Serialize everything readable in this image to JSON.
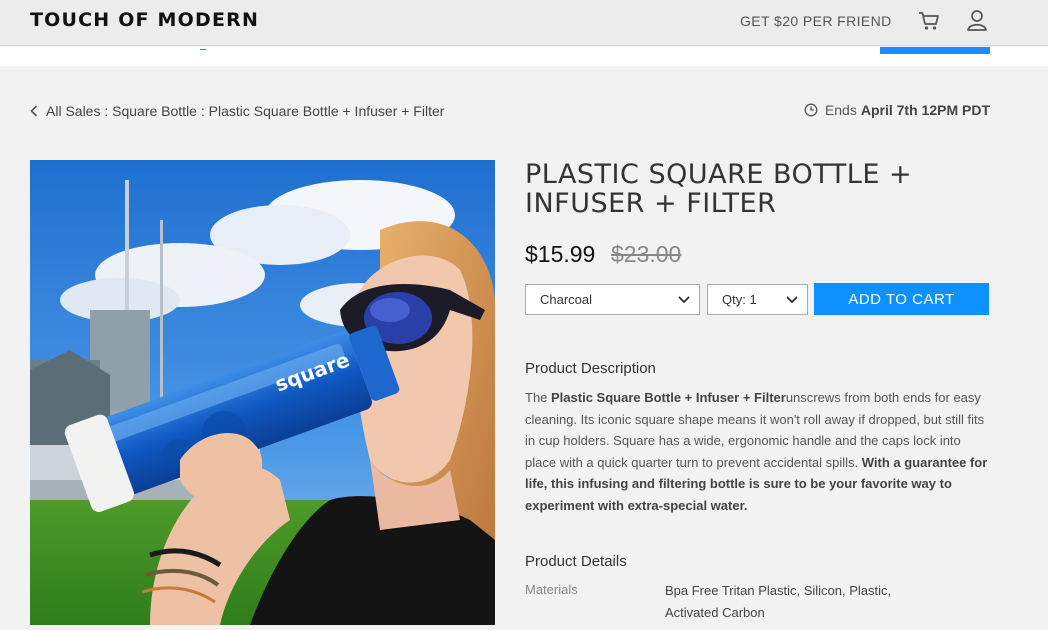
{
  "header": {
    "logo": "TOUCH OF MODERN",
    "invite_label": "GET $20 PER FRIEND",
    "cart_icon": "cart-icon",
    "user_icon": "user-icon"
  },
  "breadcrumb": {
    "text": "All Sales : Square Bottle : Plastic Square Bottle + Infuser + Filter"
  },
  "sale_end": {
    "prefix": "Ends",
    "date": "April 7th 12PM PDT"
  },
  "product": {
    "title": "PLASTIC SQUARE BOTTLE + INFUSER + FILTER",
    "price": "$15.99",
    "original_price": "$23.00",
    "color_option": "Charcoal",
    "qty_option": "Qty: 1",
    "add_to_cart": "ADD TO CART",
    "image_alt": "Woman drinking from a blue square bottle outdoors",
    "bottle_logo": "square"
  },
  "description": {
    "heading": "Product Description",
    "p1_start": "The ",
    "p1_bold": "Plastic Square Bottle + Infuser + Filter",
    "p1_rest": "unscrews from both ends for easy cleaning. Its iconic square shape means it won't roll away if dropped, but still fits in cup holders. Square has a wide, ergonomic handle and the caps lock into place with a quick quarter turn to prevent accidental spills. ",
    "p1_bold_end": "With a guarantee for life, this infusing and filtering bottle is sure to be your favorite way to experiment with extra-special water."
  },
  "details": {
    "heading": "Product Details",
    "materials_label": "Materials",
    "materials_value": "Bpa Free Tritan Plastic, Silicon, Plastic, Activated Carbon"
  },
  "colors": {
    "accent": "#0d91ff",
    "header_bg": "#ececec",
    "page_bg": "#f2f2f2"
  }
}
